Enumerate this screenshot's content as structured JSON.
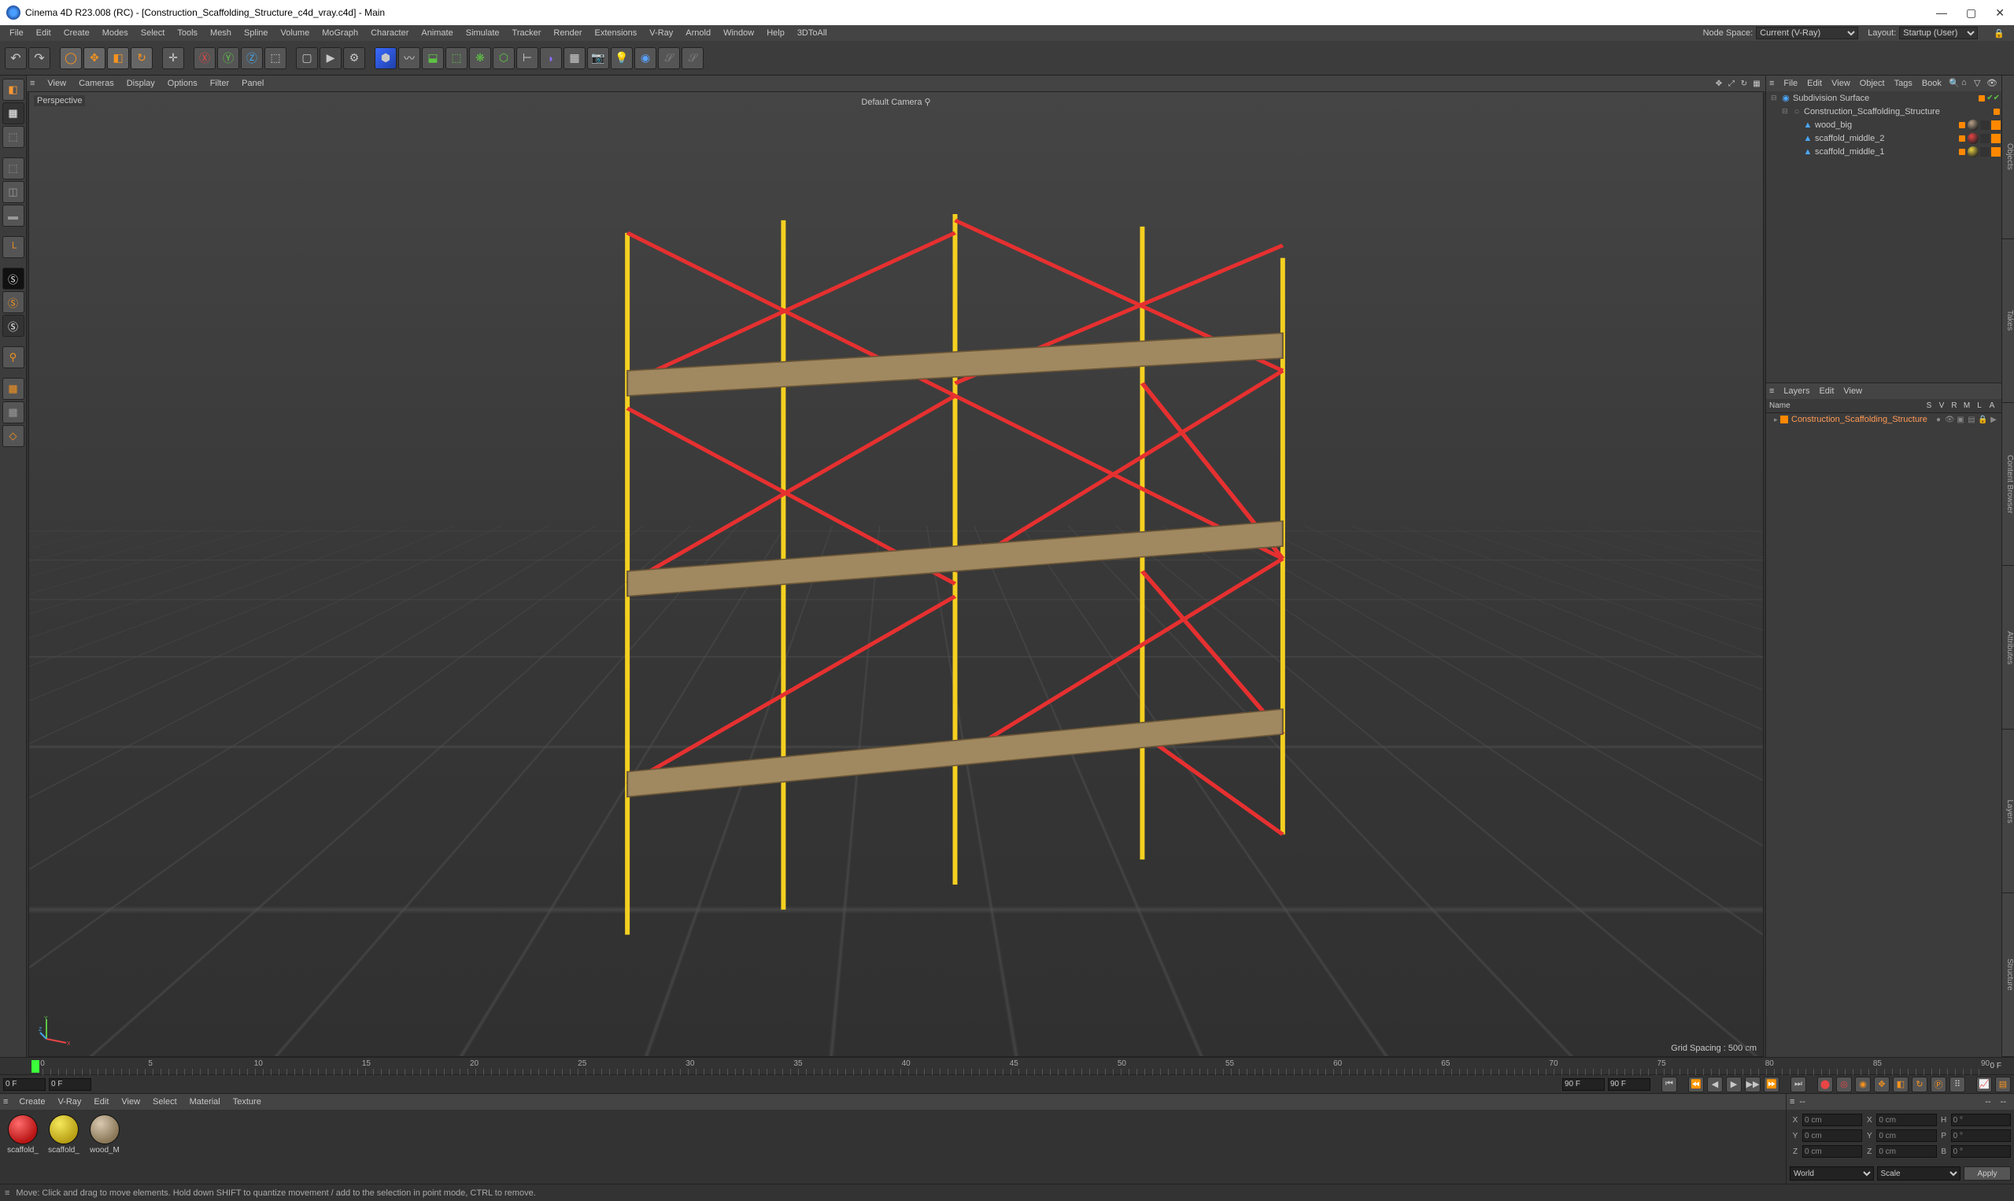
{
  "window": {
    "title": "Cinema 4D R23.008 (RC) - [Construction_Scaffolding_Structure_c4d_vray.c4d] - Main",
    "min": "—",
    "max": "▢",
    "close": "✕"
  },
  "menu": {
    "items": [
      "File",
      "Edit",
      "Create",
      "Modes",
      "Select",
      "Tools",
      "Mesh",
      "Spline",
      "Volume",
      "MoGraph",
      "Character",
      "Animate",
      "Simulate",
      "Tracker",
      "Render",
      "Extensions",
      "V-Ray",
      "Arnold",
      "Window",
      "Help",
      "3DToAll"
    ],
    "nodespace_label": "Node Space:",
    "nodespace_value": "Current (V-Ray)",
    "layout_label": "Layout:",
    "layout_value": "Startup (User)"
  },
  "view_menu": {
    "items": [
      "View",
      "Cameras",
      "Display",
      "Options",
      "Filter",
      "Panel"
    ]
  },
  "viewport": {
    "persp": "Perspective",
    "camera": "Default Camera",
    "grid": "Grid Spacing : 500 cm",
    "gizmo": {
      "x": "X",
      "y": "Y",
      "z": "Z"
    }
  },
  "obj_menu": {
    "items": [
      "File",
      "Edit",
      "View",
      "Object",
      "Tags",
      "Book"
    ]
  },
  "tree": [
    {
      "indent": 0,
      "exp": "⊟",
      "ico": "subd",
      "name": "Subdivision Surface",
      "dots": [
        "orange"
      ],
      "chk": true,
      "tags": []
    },
    {
      "indent": 1,
      "exp": "⊟",
      "ico": "null",
      "name": "Construction_Scaffolding_Structure",
      "dots": [
        "orange"
      ],
      "chk": false,
      "tags": []
    },
    {
      "indent": 2,
      "exp": "",
      "ico": "poly",
      "name": "wood_big",
      "dots": [
        "orange"
      ],
      "chk": false,
      "tags": [
        {
          "type": "sphere",
          "color": "#b8a088"
        },
        {
          "type": "sq",
          "color": "#333"
        },
        {
          "type": "sq",
          "color": "#ff8800"
        }
      ]
    },
    {
      "indent": 2,
      "exp": "",
      "ico": "poly",
      "name": "scaffold_middle_2",
      "dots": [
        "orange"
      ],
      "chk": false,
      "tags": [
        {
          "type": "sphere",
          "color": "#e84545"
        },
        {
          "type": "sq",
          "color": "#333"
        },
        {
          "type": "sq",
          "color": "#ff8800"
        }
      ]
    },
    {
      "indent": 2,
      "exp": "",
      "ico": "poly",
      "name": "scaffold_middle_1",
      "dots": [
        "orange"
      ],
      "chk": false,
      "tags": [
        {
          "type": "sphere",
          "color": "#e8d040"
        },
        {
          "type": "sq",
          "color": "#333"
        },
        {
          "type": "sq",
          "color": "#ff8800"
        }
      ]
    }
  ],
  "layers_menu": {
    "items": [
      "Layers",
      "Edit",
      "View"
    ]
  },
  "layers_cols": {
    "name": "Name",
    "cols": [
      "S",
      "V",
      "R",
      "M",
      "L",
      "A"
    ]
  },
  "layers": [
    {
      "name": "Construction_Scaffolding_Structure"
    }
  ],
  "side_tabs": [
    "Objects",
    "Takes",
    "Content Browser",
    "Attributes",
    "Layers",
    "Structure"
  ],
  "timeline": {
    "ticks": [
      0,
      5,
      10,
      15,
      20,
      25,
      30,
      35,
      40,
      45,
      50,
      55,
      60,
      65,
      70,
      75,
      80,
      85,
      90
    ],
    "start": "0 F",
    "end": "90 F",
    "label_end": "0 F"
  },
  "timenav": {
    "start_in": "0 F",
    "cur_in": "0 F",
    "end_in": "90 F",
    "end2_in": "90 F"
  },
  "mat_menu": {
    "items": [
      "Create",
      "V-Ray",
      "Edit",
      "View",
      "Select",
      "Material",
      "Texture"
    ]
  },
  "materials": [
    {
      "name": "scaffold_",
      "color": "radial-gradient(circle at 35% 30%, #ff6b6b, #b81515 70%)"
    },
    {
      "name": "scaffold_",
      "color": "radial-gradient(circle at 35% 30%, #f5e85a, #b8a015 70%)"
    },
    {
      "name": "wood_M",
      "color": "radial-gradient(circle at 35% 30%, #d8c8b0, #8a7858 70%)"
    }
  ],
  "coords": {
    "header_dashes": "--",
    "rows": [
      [
        "X",
        "0 cm",
        "X",
        "0 cm",
        "H",
        "0 °"
      ],
      [
        "Y",
        "0 cm",
        "Y",
        "0 cm",
        "P",
        "0 °"
      ],
      [
        "Z",
        "0 cm",
        "Z",
        "0 cm",
        "B",
        "0 °"
      ]
    ],
    "world": "World",
    "scale": "Scale",
    "apply": "Apply"
  },
  "status": "Move: Click and drag to move elements. Hold down SHIFT to quantize movement / add to the selection in point mode, CTRL to remove."
}
